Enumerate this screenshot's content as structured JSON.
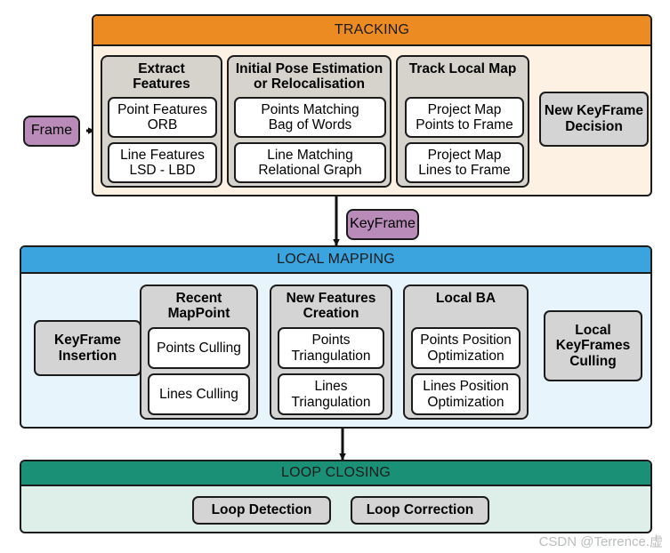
{
  "diagram": {
    "title": "SLAM pipeline block diagram",
    "watermark": "CSDN @Terrence.虚",
    "colors": {
      "tracking_header": "#ED8B23",
      "tracking_body": "#FDF1E4",
      "local_mapping_header": "#3BA3DE",
      "local_mapping_body": "#E8F4FC",
      "loop_closing_header": "#1A9176",
      "loop_closing_body": "#DEEEE8",
      "group_fill": "#D6D3CD",
      "grey_box": "#D4D4D4",
      "purple_token": "#B98BB9",
      "stroke": "#1B1B1B"
    }
  },
  "tokens": {
    "frame": "Frame",
    "keyframe": "KeyFrame"
  },
  "tracking": {
    "header": "TRACKING",
    "groups": [
      {
        "title": "Extract\nFeatures",
        "items": [
          "Point Features\nORB",
          "Line Features\nLSD - LBD"
        ]
      },
      {
        "title": "Initial Pose Estimation\nor Relocalisation",
        "items": [
          "Points Matching\nBag of Words",
          "Line Matching\nRelational Graph"
        ]
      },
      {
        "title": "Track Local Map",
        "items": [
          "Project Map\nPoints to Frame",
          "Project Map\nLines to Frame"
        ]
      }
    ],
    "standalone": [
      "New KeyFrame\nDecision"
    ]
  },
  "local_mapping": {
    "header": "LOCAL MAPPING",
    "leading_standalone": [
      "KeyFrame\nInsertion"
    ],
    "groups": [
      {
        "title": "Recent\nMapPoint",
        "items": [
          "Points Culling",
          "Lines Culling"
        ]
      },
      {
        "title": "New Features\nCreation",
        "items": [
          "Points\nTriangulation",
          "Lines\nTriangulation"
        ]
      },
      {
        "title": "Local BA",
        "items": [
          "Points Position\nOptimization",
          "Lines Position\nOptimization"
        ]
      }
    ],
    "trailing_standalone": [
      "Local\nKeyFrames\nCulling"
    ]
  },
  "loop_closing": {
    "header": "LOOP CLOSING",
    "items": [
      "Loop Detection",
      "Loop Correction"
    ]
  }
}
